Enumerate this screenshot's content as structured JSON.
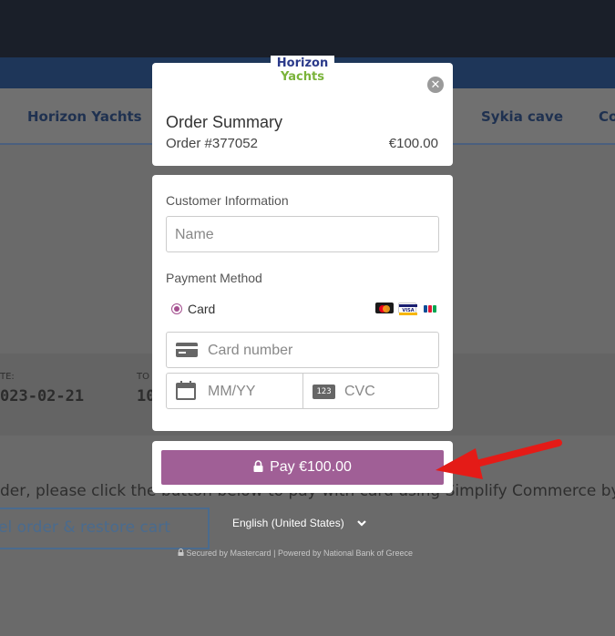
{
  "background": {
    "nav_items": [
      "Horizon Yachts",
      "Sykia cave",
      "Co"
    ],
    "date_label": "TE:",
    "date_value": "023-02-21",
    "to_label": "TO",
    "to_value": "10",
    "instruction_text": "der, please click the button below to pay with card using Simplify Commerce by",
    "cancel_label": "el order & restore cart"
  },
  "logo": {
    "line1": "Horizon",
    "line2": "Yachts"
  },
  "summary": {
    "title": "Order Summary",
    "order_number": "Order #377052",
    "amount": "€100.00"
  },
  "customer": {
    "heading": "Customer Information",
    "name_placeholder": "Name"
  },
  "payment": {
    "heading": "Payment Method",
    "method_label": "Card",
    "brands": [
      "mastercard-icon",
      "visa-icon",
      "jcb-icon"
    ],
    "card_number_placeholder": "Card number",
    "expiry_placeholder": "MM/YY",
    "cvc_placeholder": "CVC",
    "cvc_icon_text": "123"
  },
  "pay_button": {
    "label": "Pay €100.00"
  },
  "language": {
    "selected": "English (United States)"
  },
  "footer": {
    "secured": "Secured by Mastercard",
    "separator": "|",
    "powered": "Powered by National Bank of Greece"
  },
  "colors": {
    "accent": "#a05f96",
    "annotation_arrow": "#e41b17"
  }
}
